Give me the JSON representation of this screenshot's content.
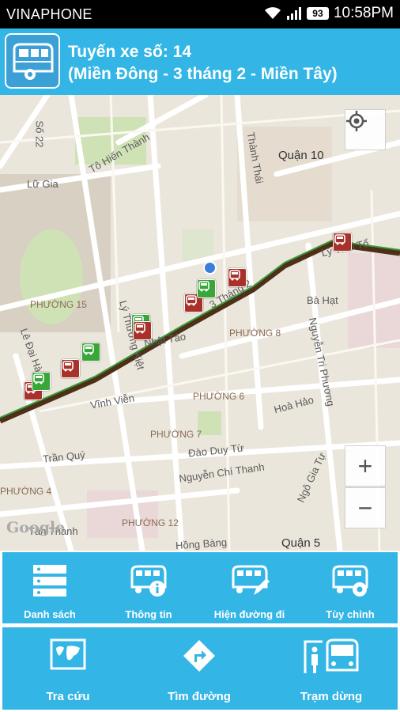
{
  "status_bar": {
    "carrier": "VINAPHONE",
    "battery": "93",
    "time": "10:58PM"
  },
  "header": {
    "title_line1": "Tuyến xe số: 14",
    "title_line2": "(Miền Đông - 3 tháng 2 - Miền Tây)",
    "icon": "bus-logo-icon"
  },
  "map": {
    "labels": {
      "so22": "Số 22",
      "to_hien_thanh": "Tô Hiến Thành",
      "lu_gia": "Lữ Gia",
      "thanh_thai": "Thành Thái",
      "quan10": "Quận 10",
      "phuong15": "PHƯỜNG 15",
      "ly_thuong_kiet": "Lý Thường Kiệt",
      "le_dai_hanh": "Lê Đại Hành",
      "nhat_tao": "Nhật Tảo",
      "phuong8": "PHƯỜNG 8",
      "ba_hat": "Bà Hạt",
      "nguyen_tri_phuong": "Nguyễn Tri Phương",
      "vinh_vien": "Vĩnh Viễn",
      "phuong6": "PHƯỜNG 6",
      "hoa_hao": "Hoà Hảo",
      "phuong7": "PHƯỜNG 7",
      "dao_duy_tu": "Đào Duy Từ",
      "tran_quy": "Trần Quý",
      "nguyen_chi_thanh": "Nguyễn Chí Thanh",
      "ngo_gia_tu": "Ngô Gia Tự",
      "phuong4": "PHƯỜNG 4",
      "tan_thanh": "Tân Thành",
      "phuong12": "PHƯỜNG 12",
      "hung_bang": "Hồng Bàng",
      "quan5": "Quận 5",
      "ly_thai_to": "Lý Thái Tổ",
      "ba_thang_hai": "3 Tháng 2",
      "google": "Google"
    },
    "controls": {
      "my_location_icon": "crosshair-icon",
      "zoom_in": "+",
      "zoom_out": "−"
    },
    "route_color": "#4e2f17",
    "route_highlight": "#3a9a3a",
    "stop_red": "#a8322a",
    "stop_green": "#3aa538"
  },
  "toolbar_top": [
    {
      "label": "Danh sách",
      "icon": "list-icon"
    },
    {
      "label": "Thông tin",
      "icon": "bus-info-icon"
    },
    {
      "label": "Hiện đường đi",
      "icon": "bus-edit-icon"
    },
    {
      "label": "Tùy chỉnh",
      "icon": "bus-settings-icon"
    }
  ],
  "toolbar_bottom": [
    {
      "label": "Tra cứu",
      "icon": "world-map-icon"
    },
    {
      "label": "Tìm đường",
      "icon": "direction-sign-icon"
    },
    {
      "label": "Trạm dừng",
      "icon": "bus-stop-icon"
    }
  ],
  "colors": {
    "header": "#33b5e5",
    "status_bar": "#000000"
  }
}
